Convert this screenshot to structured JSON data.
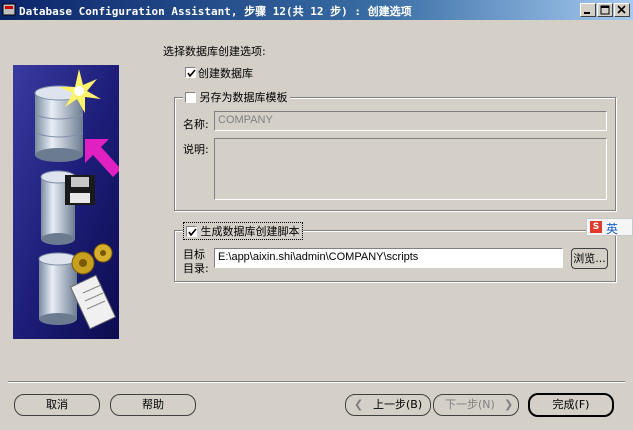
{
  "window": {
    "title": "Database Configuration Assistant, 步骤 12(共 12 步) : 创建选项"
  },
  "options": {
    "heading": "选择数据库创建选项:",
    "create_db_label": "创建数据库",
    "create_db_checked": true,
    "save_template_label": "另存为数据库模板",
    "save_template_checked": false,
    "name_label": "名称:",
    "name_value": "COMPANY",
    "description_label": "说明:",
    "description_value": "",
    "gen_script_label": "生成数据库创建脚本",
    "gen_script_checked": true,
    "dest_label_line1": "目标",
    "dest_label_line2": "目录:",
    "dest_value": "E:\\app\\aixin.shi\\admin\\COMPANY\\scripts",
    "browse_label": "浏览..."
  },
  "ime": {
    "label": "英"
  },
  "footer": {
    "cancel_label": "取消",
    "help_label": "帮助",
    "back_label": "上一步(B)",
    "next_label": "下一步(N)",
    "finish_label": "完成(F)"
  }
}
